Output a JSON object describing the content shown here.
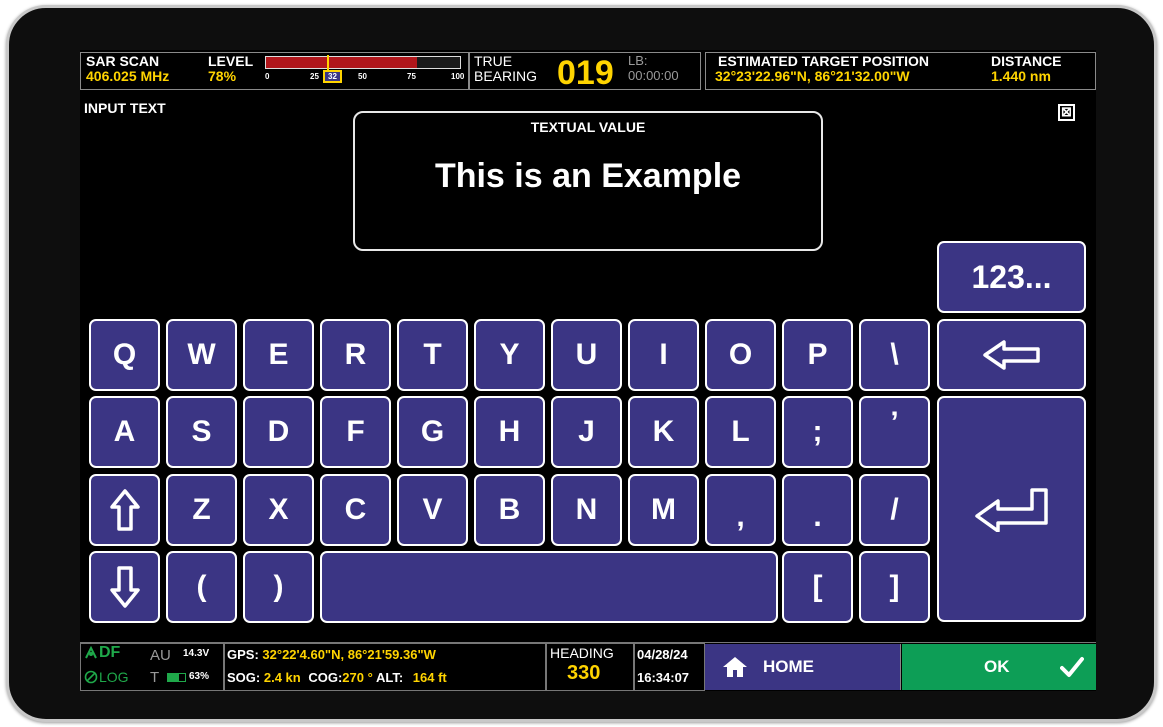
{
  "topbar": {
    "sar_label": "SAR SCAN",
    "sar_freq": "406.025 MHz",
    "level_label": "LEVEL",
    "level_value": "78%",
    "level_percent": 78,
    "level_marker": 32,
    "level_ticks": [
      "0",
      "25",
      "32",
      "50",
      "75",
      "100"
    ],
    "true_label": "TRUE",
    "bearing_label": "BEARING",
    "bearing_value": "019",
    "lb_label": "LB:",
    "lb_time": "00:00:00",
    "target_label": "ESTIMATED TARGET POSITION",
    "target_value": "32°23'22.96\"N,  86°21'32.00\"W",
    "distance_label": "DISTANCE",
    "distance_value": "1.440 nm"
  },
  "input": {
    "title": "INPUT TEXT",
    "panel_label": "TEXTUAL VALUE",
    "value": "This is an Example",
    "close_symbol": "⊠"
  },
  "keyboard": {
    "mode_key": "123...",
    "row1": [
      "Q",
      "W",
      "E",
      "R",
      "T",
      "Y",
      "U",
      "I",
      "O",
      "P",
      "\\"
    ],
    "row2": [
      "A",
      "S",
      "D",
      "F",
      "G",
      "H",
      "J",
      "K",
      "L",
      ";",
      "’"
    ],
    "row3": [
      "Z",
      "X",
      "C",
      "V",
      "B",
      "N",
      "M",
      ",",
      ".",
      "/"
    ],
    "row4": [
      "(",
      ")",
      "[",
      "]"
    ]
  },
  "botbar": {
    "df_label": "DF",
    "log_label": "LOG",
    "au_label": "AU",
    "voltage": "14.3V",
    "t_label": "T",
    "battery": "63%",
    "battery_level": 63,
    "gps_label": "GPS:",
    "gps_value": "32°22'4.60\"N,  86°21'59.36\"W",
    "sog_label": "SOG:",
    "sog_value": "2.4 kn",
    "cog_label": "COG:",
    "cog_value": "270 °",
    "alt_label": "ALT:",
    "alt_value": "164 ft",
    "heading_label": "HEADING",
    "heading_value": "330",
    "date": "04/28/24",
    "time": "16:34:07",
    "home_label": "HOME",
    "ok_label": "OK"
  },
  "colors": {
    "key_fill": "#3b3584",
    "accent_yellow": "#ffd400",
    "ok_green": "#0d9e56",
    "level_red": "#b0161b",
    "status_green": "#1fa84a"
  }
}
